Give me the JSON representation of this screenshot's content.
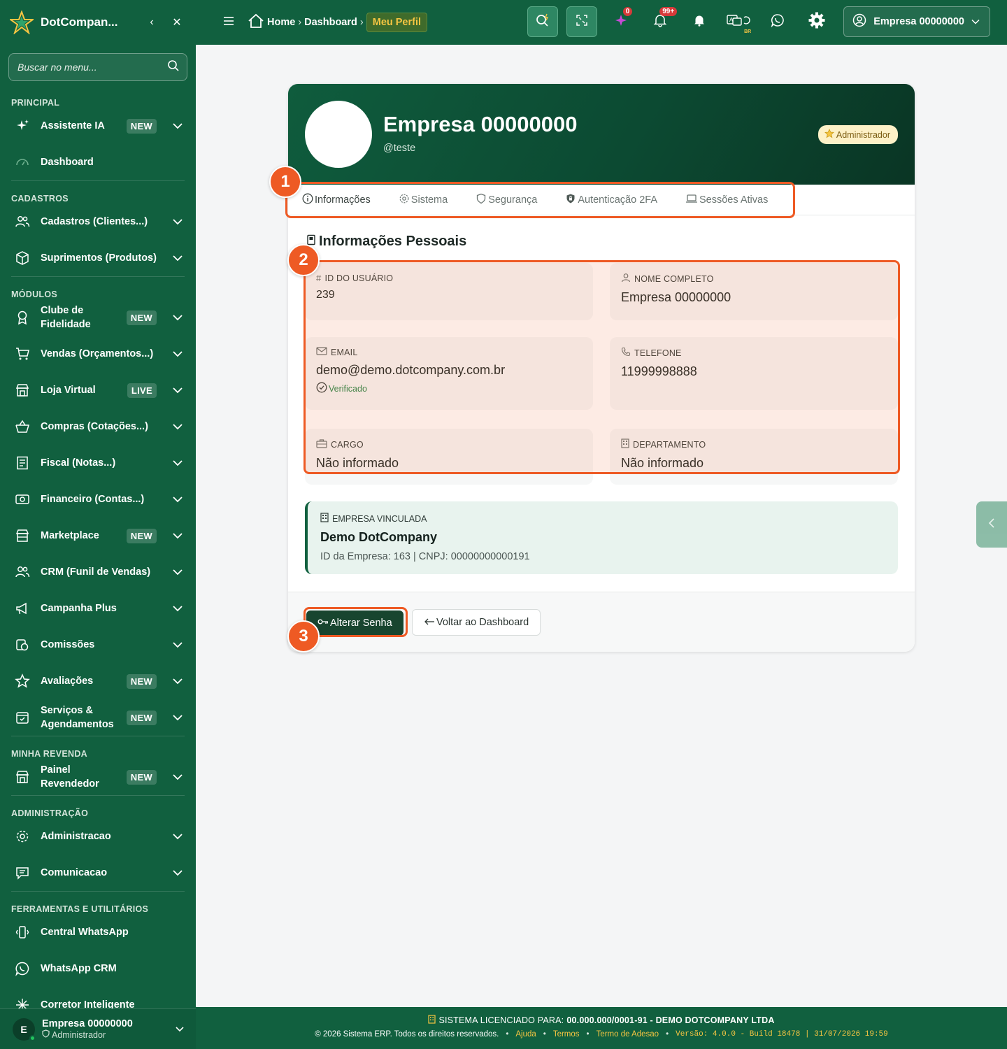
{
  "sidebar": {
    "brand": "DotCompan...",
    "search_placeholder": "Buscar no menu...",
    "sections": {
      "principal": "PRINCIPAL",
      "cadastros": "CADASTROS",
      "modulos": "MÓDULOS",
      "minha_revenda": "MINHA REVENDA",
      "administracao": "ADMINISTRAÇÃO",
      "ferramentas": "FERRAMENTAS E UTILITÁRIOS"
    },
    "items": {
      "assistente": {
        "label": "Assistente IA",
        "badge": "NEW",
        "icon": "sparkle-icon"
      },
      "dashboard": {
        "label": "Dashboard",
        "icon": "gauge-icon"
      },
      "cadastros": {
        "label": "Cadastros (Clientes...)",
        "icon": "users-icon"
      },
      "suprimentos": {
        "label": "Suprimentos (Produtos)",
        "icon": "box-icon"
      },
      "clube": {
        "label": "Clube de Fidelidade",
        "badge": "NEW",
        "icon": "award-icon"
      },
      "vendas": {
        "label": "Vendas (Orçamentos...)",
        "icon": "cart-icon"
      },
      "loja": {
        "label": "Loja Virtual",
        "badge": "LIVE",
        "icon": "store-icon"
      },
      "compras": {
        "label": "Compras (Cotações...)",
        "icon": "basket-icon"
      },
      "fiscal": {
        "label": "Fiscal (Notas...)",
        "icon": "receipt-icon"
      },
      "financeiro": {
        "label": "Financeiro (Contas...)",
        "icon": "money-icon"
      },
      "marketplace": {
        "label": "Marketplace",
        "badge": "NEW",
        "icon": "shop-icon"
      },
      "crm": {
        "label": "CRM (Funil de Vendas)",
        "icon": "users-icon"
      },
      "campanha": {
        "label": "Campanha Plus",
        "icon": "megaphone-icon"
      },
      "comissoes": {
        "label": "Comissões",
        "icon": "coins-icon"
      },
      "avaliacoes": {
        "label": "Avaliações",
        "badge": "NEW",
        "icon": "star-icon"
      },
      "servicos": {
        "label": "Serviços & Agendamentos",
        "badge": "NEW",
        "icon": "calendar-icon"
      },
      "painel": {
        "label": "Painel Revendedor",
        "badge": "NEW",
        "icon": "store-icon"
      },
      "administracao": {
        "label": "Administracao",
        "icon": "gear-icon"
      },
      "comunicacao": {
        "label": "Comunicacao",
        "icon": "message-icon"
      },
      "central_whatsapp": {
        "label": "Central WhatsApp",
        "icon": "phone-vibrate-icon"
      },
      "whatsapp_crm": {
        "label": "WhatsApp CRM",
        "icon": "whatsapp-icon"
      },
      "corretor": {
        "label": "Corretor Inteligente",
        "icon": "sparkle-icon"
      }
    },
    "user": {
      "initial": "E",
      "name": "Empresa 00000000",
      "role": "Administrador"
    }
  },
  "topbar": {
    "breadcrumb": {
      "home": "Home",
      "dashboard": "Dashboard",
      "current": "Meu Perfil"
    },
    "ai_count": "0",
    "notif_count": "99+",
    "lang_badge": "BR",
    "user_label": "Empresa 00000000"
  },
  "profile": {
    "name": "Empresa 00000000",
    "username": "@teste",
    "role_badge": "Administrador",
    "tabs": [
      "Informações",
      "Sistema",
      "Segurança",
      "Autenticação 2FA",
      "Sessões Ativas"
    ],
    "section_title": "Informações Pessoais",
    "fields": {
      "id": {
        "label": "ID DO USUÁRIO",
        "value": "239"
      },
      "nome": {
        "label": "NOME COMPLETO",
        "value": "Empresa 00000000"
      },
      "email": {
        "label": "EMAIL",
        "value": "demo@demo.dotcompany.com.br",
        "status": "Verificado"
      },
      "telefone": {
        "label": "TELEFONE",
        "value": "11999998888"
      },
      "cargo": {
        "label": "CARGO",
        "value": "Não informado"
      },
      "departamento": {
        "label": "DEPARTAMENTO",
        "value": "Não informado"
      }
    },
    "company": {
      "label": "EMPRESA VINCULADA",
      "name": "Demo DotCompany",
      "meta": "ID da Empresa: 163 | CNPJ: 00000000000191"
    },
    "actions": {
      "change_password": "Alterar Senha",
      "back": "Voltar ao Dashboard"
    }
  },
  "annotations": [
    "1",
    "2",
    "3"
  ],
  "footer": {
    "license_label": "SISTEMA LICENCIADO PARA:",
    "license_value": "00.000.000/0001-91 - DEMO DOTCOMPANY LTDA",
    "copyright": "© 2026 Sistema ERP. Todos os direitos reservados.",
    "links": [
      "Ajuda",
      "Termos",
      "Termo de Adesao"
    ],
    "version": "Versão: 4.0.0 - Build 18478 | 31/07/2026 19:59"
  },
  "colors": {
    "brand_green": "#11603f",
    "accent_orange": "#ee5a24",
    "gold": "#f5c542"
  }
}
